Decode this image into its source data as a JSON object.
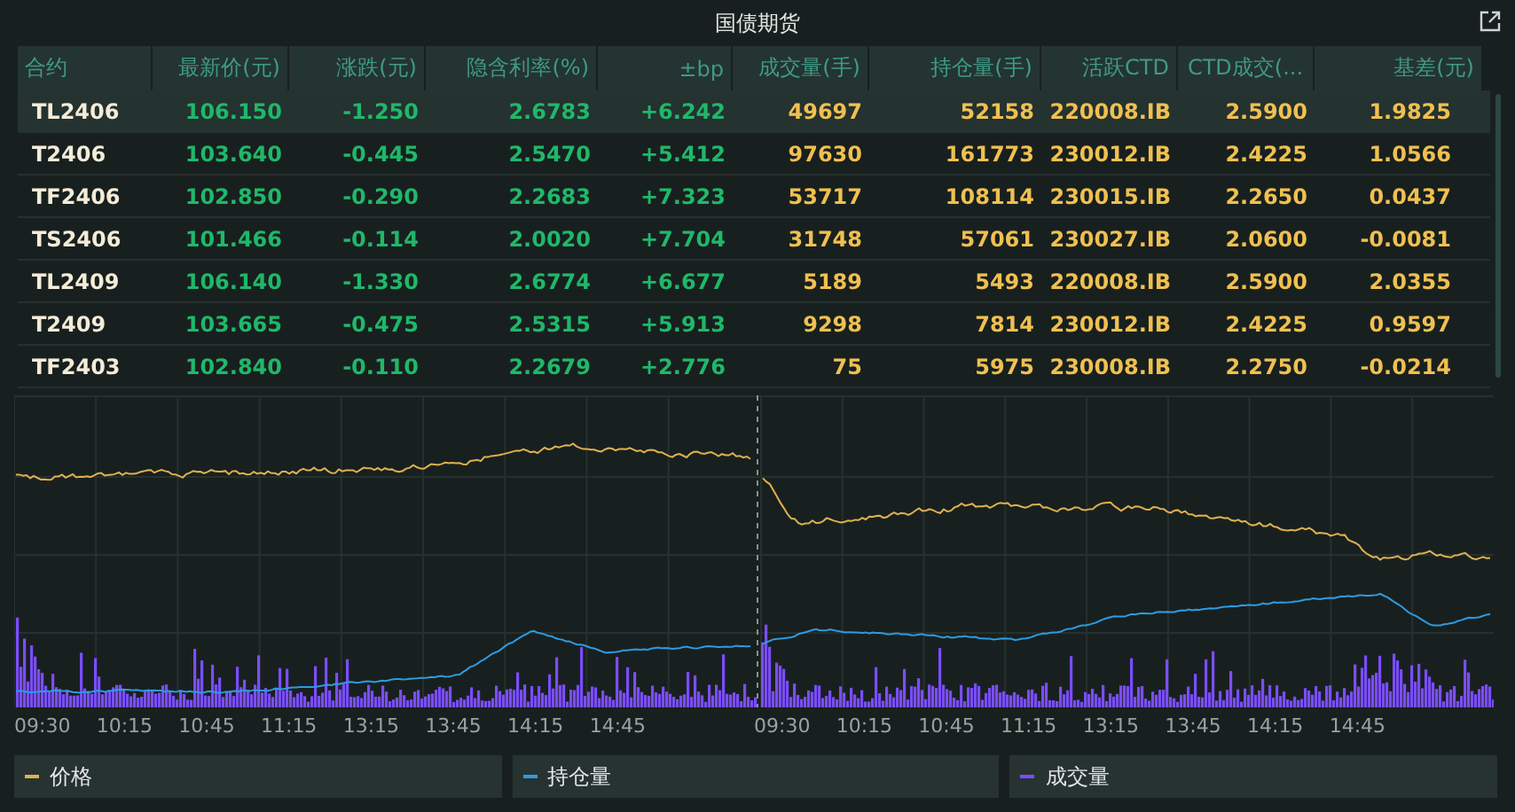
{
  "title": "国债期货",
  "table": {
    "columns": [
      "合约",
      "最新价(元)",
      "涨跌(元)",
      "隐含利率(%)",
      "±bp",
      "成交量(手)",
      "持仓量(手)",
      "活跃CTD",
      "CTD成交(...",
      "基差(元)"
    ],
    "rows": [
      {
        "selected": true,
        "cells": [
          "TL2406",
          "106.150",
          "-1.250",
          "2.6783",
          "+6.242",
          "49697",
          "52158",
          "220008.IB",
          "2.5900",
          "1.9825"
        ]
      },
      {
        "selected": false,
        "cells": [
          "T2406",
          "103.640",
          "-0.445",
          "2.5470",
          "+5.412",
          "97630",
          "161773",
          "230012.IB",
          "2.4225",
          "1.0566"
        ]
      },
      {
        "selected": false,
        "cells": [
          "TF2406",
          "102.850",
          "-0.290",
          "2.2683",
          "+7.323",
          "53717",
          "108114",
          "230015.IB",
          "2.2650",
          "0.0437"
        ]
      },
      {
        "selected": false,
        "cells": [
          "TS2406",
          "101.466",
          "-0.114",
          "2.0020",
          "+7.704",
          "31748",
          "57061",
          "230027.IB",
          "2.0600",
          "-0.0081"
        ]
      },
      {
        "selected": false,
        "cells": [
          "TL2409",
          "106.140",
          "-1.330",
          "2.6774",
          "+6.677",
          "5189",
          "5493",
          "220008.IB",
          "2.5900",
          "2.0355"
        ]
      },
      {
        "selected": false,
        "cells": [
          "T2409",
          "103.665",
          "-0.475",
          "2.5315",
          "+5.913",
          "9298",
          "7814",
          "230012.IB",
          "2.4225",
          "0.9597"
        ]
      },
      {
        "selected": false,
        "cells": [
          "TF2403",
          "102.840",
          "-0.110",
          "2.2679",
          "+2.776",
          "75",
          "5975",
          "230008.IB",
          "2.2750",
          "-0.0214"
        ]
      }
    ]
  },
  "chart": {
    "sessions": [
      {
        "x_labels": [
          "09:30",
          "10:15",
          "10:45",
          "11:15",
          "13:15",
          "13:45",
          "14:15",
          "14:45"
        ]
      },
      {
        "x_labels": [
          "09:30",
          "10:15",
          "10:45",
          "11:15",
          "13:15",
          "13:45",
          "14:15",
          "14:45"
        ]
      }
    ],
    "legend": [
      {
        "label": "价格",
        "color": "#e0b050"
      },
      {
        "label": "持仓量",
        "color": "#2e9be0"
      },
      {
        "label": "成交量",
        "color": "#7b4dff"
      }
    ]
  }
}
